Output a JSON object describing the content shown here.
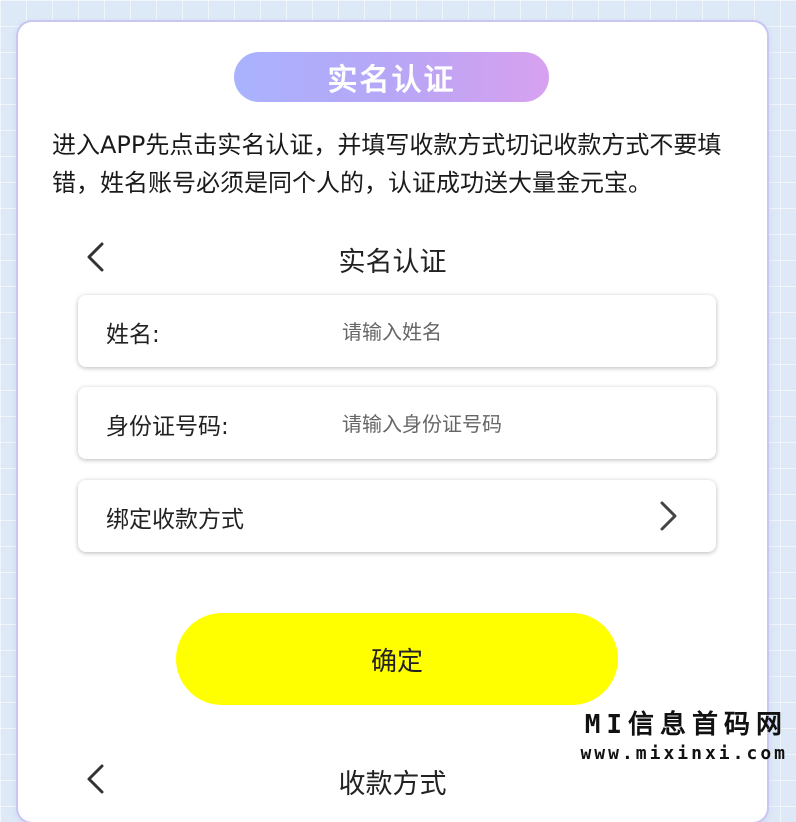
{
  "header": {
    "badge_title": "实名认证"
  },
  "instructions": "进入APP先点击实名认证，并填写收款方式切记收款方式不要填错，姓名账号必须是同个人的，认证成功送大量金元宝。",
  "screen1": {
    "title": "实名认证",
    "fields": [
      {
        "label": "姓名:",
        "placeholder": "请输入姓名",
        "value": ""
      },
      {
        "label": "身份证号码:",
        "placeholder": "请输入身份证号码",
        "value": ""
      }
    ],
    "bind_payment_label": "绑定收款方式",
    "confirm_label": "确定"
  },
  "screen2": {
    "title": "收款方式"
  },
  "watermark": {
    "line1": "MI信息首码网",
    "line2": "www.mixinxi.com"
  },
  "colors": {
    "accent_yellow": "#ffff00",
    "pill_start": "#a9b3ff",
    "pill_end": "#d7a1ef"
  },
  "icons": {
    "back": "chevron-left-icon",
    "forward": "chevron-right-icon"
  }
}
